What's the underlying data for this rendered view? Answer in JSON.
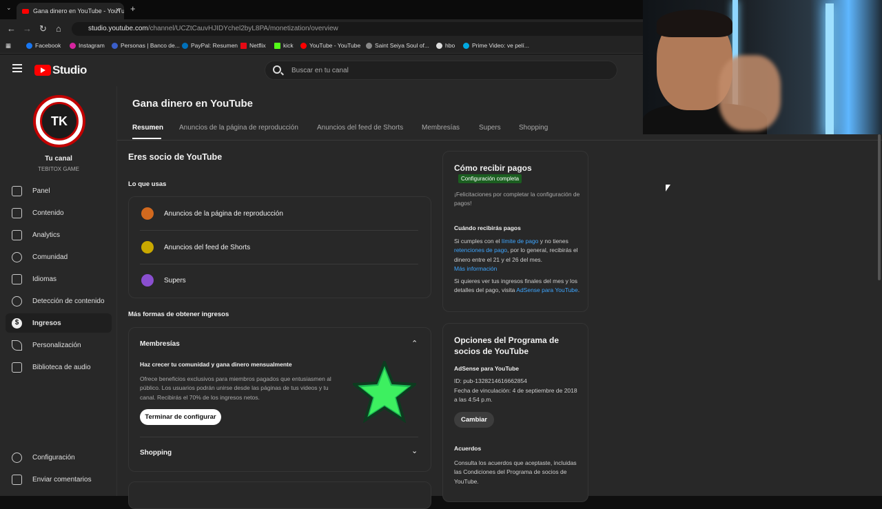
{
  "browser": {
    "tab_title": "Gana dinero en YouTube - YouTube",
    "url_domain": "studio.youtube.com",
    "url_path": "/channel/UCZtCauvHJIDYchel2byL8PA/monetization/overview",
    "bookmarks": [
      "Facebook",
      "Instagram",
      "Personas | Banco de...",
      "PayPal: Resumen",
      "Netflix",
      "kick",
      "YouTube - YouTube",
      "Saint Seiya Soul of...",
      "hbo",
      "Prime Video: ve pelí..."
    ]
  },
  "header": {
    "logo_text": "Studio",
    "search_placeholder": "Buscar en tu canal"
  },
  "sidebar": {
    "channel_label": "Tu canal",
    "channel_name": "TEBITOX GAME",
    "avatar_text": "TK",
    "items": [
      "Panel",
      "Contenido",
      "Analytics",
      "Comunidad",
      "Idiomas",
      "Detección de contenido",
      "Ingresos",
      "Personalización",
      "Biblioteca de audio"
    ],
    "footer_items": [
      "Configuración",
      "Enviar comentarios"
    ]
  },
  "page": {
    "title": "Gana dinero en YouTube",
    "tabs": [
      "Resumen",
      "Anuncios de la página de reproducción",
      "Anuncios del feed de Shorts",
      "Membresías",
      "Supers",
      "Shopping"
    ]
  },
  "left": {
    "heading": "Eres socio de YouTube",
    "using_label": "Lo que usas",
    "using_items": [
      "Anuncios de la página de reproducción",
      "Anuncios del feed de Shorts",
      "Supers"
    ],
    "more_label": "Más formas de obtener ingresos",
    "memberships_title": "Membresías",
    "memberships_sub": "Haz crecer tu comunidad y gana dinero mensualmente",
    "memberships_desc": "Ofrece beneficios exclusivos para miembros pagados que entusiasmen al público. Los usuarios podrán unirse desde las páginas de tus videos y tu canal. Recibirás el 70% de los ingresos netos.",
    "memberships_button": "Terminar de configurar",
    "shopping_title": "Shopping"
  },
  "payments": {
    "title": "Cómo recibir pagos",
    "badge": "Configuración completa",
    "congrats": "¡Felicitaciones por completar la configuración de pagos!",
    "when_title": "Cuándo recibirás pagos",
    "when_p1": "Si cumples con el",
    "when_link1": "límite de pago",
    "when_p2": "y no tienes",
    "when_link2": "retenciones de pago",
    "when_p3": ", por lo general, recibirás el dinero entre el 21 y el 26 del mes.",
    "more_info": "Más información",
    "final_p": "Si quieres ver tus ingresos finales del mes y los detalles del pago, visita",
    "final_link": "AdSense para YouTube",
    "final_end": "."
  },
  "program": {
    "title": "Opciones del Programa de socios de YouTube",
    "adsense_title": "AdSense para YouTube",
    "id_line": "ID: pub-1328214616662854",
    "link_date": "Fecha de vinculación: 4 de septiembre de 2018 a las 4:54 p.m.",
    "change_button": "Cambiar",
    "agreements_title": "Acuerdos",
    "agreements_text": "Consulta los acuerdos que aceptaste, incluidas las Condiciones del Programa de socios de YouTube."
  },
  "colors": {
    "accent_red": "#ff0000",
    "link": "#3ea6ff",
    "badge_green": "#1b5e20",
    "bg": "#282828"
  }
}
